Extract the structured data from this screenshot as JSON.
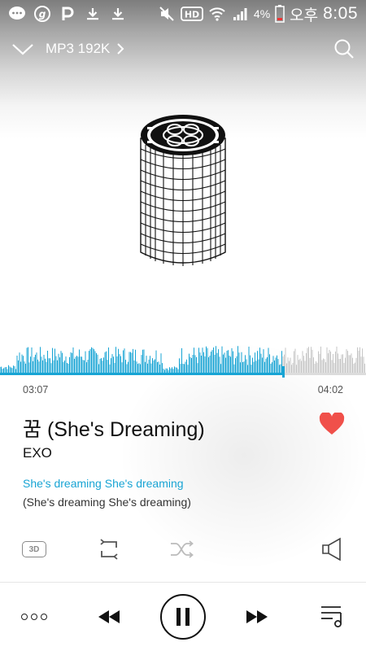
{
  "status_bar": {
    "battery": "4%",
    "carrier_text": "오후",
    "time": "8:05"
  },
  "top_bar": {
    "quality": "MP3 192K"
  },
  "player": {
    "elapsed": "03:07",
    "total": "04:02",
    "progress": 0.773
  },
  "track": {
    "title": "꿈 (She's Dreaming)",
    "artist": "EXO",
    "lyric_current": "She's dreaming She's dreaming",
    "lyric_next": "(She's dreaming She's dreaming)"
  },
  "options": {
    "label_3d": "3D"
  },
  "colors": {
    "accent": "#18a4d4",
    "like": "#f0504a"
  }
}
